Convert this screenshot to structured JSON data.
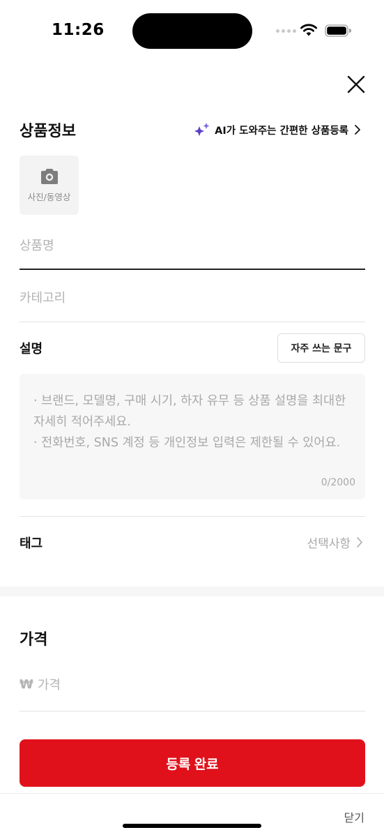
{
  "status_bar": {
    "time": "11:26"
  },
  "header": {
    "close_icon": "close-icon"
  },
  "product_info": {
    "title": "상품정보",
    "ai_link_label": "AI가 도와주는 간편한 상품등록",
    "ai_icon": "sparkle-icon",
    "ai_icon_color": "#5b3fc4",
    "photo_label": "사진/동영상",
    "photo_icon": "camera-icon",
    "name_placeholder": "상품명",
    "category_placeholder": "카테고리"
  },
  "description": {
    "label": "설명",
    "frequent_phrases_button": "자주 쓰는 문구",
    "placeholder_line1": "· 브랜드, 모델명, 구매 시기, 하자 유무 등 상품 설명을 최대한 자세히 적어주세요.",
    "placeholder_line2": "· 전화번호, SNS 계정 등 개인정보 입력은 제한될 수 있어요.",
    "counter": "0/2000"
  },
  "tag": {
    "label": "태그",
    "value": "선택사항"
  },
  "price": {
    "title": "가격",
    "currency_symbol": "₩",
    "placeholder": "가격"
  },
  "actions": {
    "submit_label": "등록 완료",
    "submit_color": "#e0111b",
    "dismiss_label": "닫기"
  }
}
